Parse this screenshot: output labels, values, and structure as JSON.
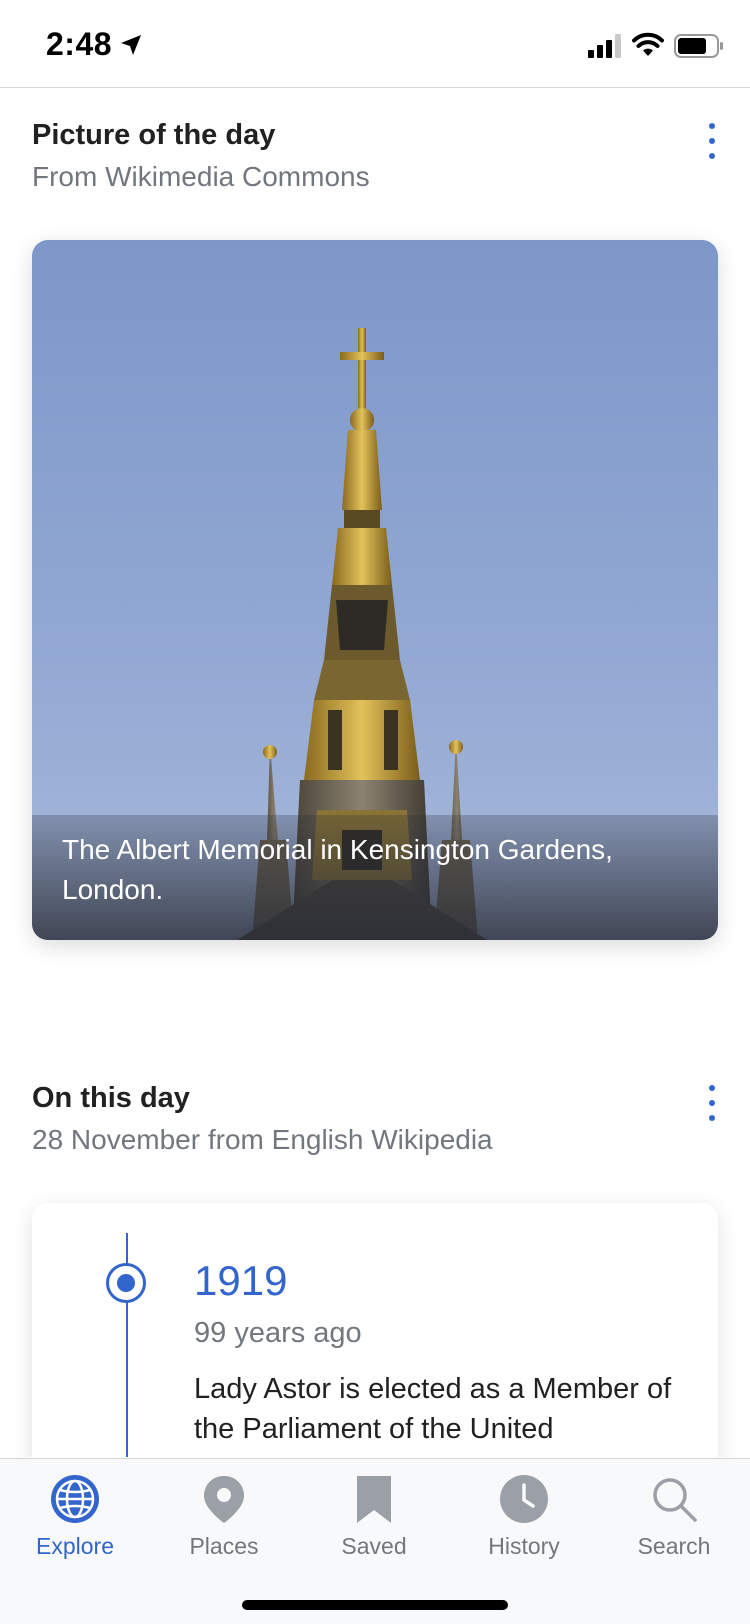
{
  "status_bar": {
    "time": "2:48",
    "icons": [
      "location-arrow-icon",
      "cellular-signal-icon",
      "wifi-icon",
      "battery-icon"
    ]
  },
  "picture_of_the_day": {
    "title": "Picture of the day",
    "subtitle": "From Wikimedia Commons",
    "caption": "The Albert Memorial in Kensington Gardens, London.",
    "more_icon": "more-vertical-icon"
  },
  "on_this_day": {
    "title": "On this day",
    "subtitle": "28 November from English Wikipedia",
    "more_icon": "more-vertical-icon",
    "event": {
      "year": "1919",
      "years_ago": "99 years ago",
      "text": "Lady Astor is elected as a Member of the Parliament of the United"
    }
  },
  "tab_bar": {
    "tabs": [
      {
        "label": "Explore",
        "icon": "globe-icon",
        "active": true
      },
      {
        "label": "Places",
        "icon": "map-pin-icon",
        "active": false
      },
      {
        "label": "Saved",
        "icon": "bookmark-icon",
        "active": false
      },
      {
        "label": "History",
        "icon": "clock-icon",
        "active": false
      },
      {
        "label": "Search",
        "icon": "search-icon",
        "active": false
      }
    ]
  },
  "colors": {
    "accent": "#3366cc",
    "inactive": "#72777d",
    "text": "#202122",
    "sky": "#8fa6d2",
    "gold": "#c9a437"
  }
}
